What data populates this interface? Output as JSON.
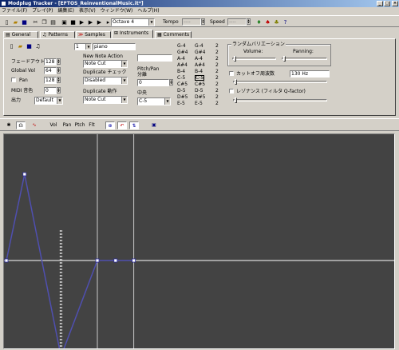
{
  "window": {
    "title": "Modplug Tracker - [EFTOS_ReinventionalMusic.it*]",
    "controls": [
      "_",
      "□",
      "×"
    ]
  },
  "menu": [
    "ファイル(F)",
    "プレイ(P)",
    "編集(E)",
    "表示(V)",
    "ウィンドウ(W)",
    "ヘルプ(H)"
  ],
  "toolbar": {
    "octave": "Octave 4",
    "tempo_label": "Tempo",
    "tempo_value": "----",
    "speed_label": "Speed",
    "speed_value": "----"
  },
  "tabs": [
    {
      "label": "General"
    },
    {
      "label": "Patterns"
    },
    {
      "label": "Samples"
    },
    {
      "label": "Instruments"
    },
    {
      "label": "Comments"
    }
  ],
  "instrument": {
    "number": "1",
    "name": "piano",
    "fadeout_label": "フェードアウト",
    "fadeout_value": "128",
    "global_vol_label": "Global Vol",
    "global_vol_value": "64",
    "pan_label": "Pan",
    "pan_value": "128",
    "midi_label": "MIDI 音色",
    "midi_value": "0",
    "output_label": "出力",
    "output_value": "Default"
  },
  "nna": {
    "title": "New Note Action",
    "value": "Note Cut",
    "duplicate_check_label": "Duplicate チェック",
    "duplicate_check_value": "Disabled",
    "duplicate_action_label": "Duplicate 動作",
    "duplicate_action_value": "Note Cut"
  },
  "pitch_pan": {
    "title": "Pitch/Pan",
    "separation_label": "分離",
    "separation_value": "0",
    "center_label": "中央",
    "center_value": "C-5"
  },
  "note_map": [
    [
      "G-4",
      "G-4",
      "2"
    ],
    [
      "G#4",
      "G#4",
      "2"
    ],
    [
      "A-4",
      "A-4",
      "2"
    ],
    [
      "A#4",
      "A#4",
      "2"
    ],
    [
      "B-4",
      "B-4",
      "2"
    ],
    [
      "C-5",
      "C-5",
      "2"
    ],
    [
      "C#5",
      "C#5",
      "2"
    ],
    [
      "D-5",
      "D-5",
      "2"
    ],
    [
      "D#5",
      "D#5",
      "2"
    ],
    [
      "E-5",
      "E-5",
      "2"
    ]
  ],
  "random_variation": {
    "title": "ランダムバリエーション",
    "volume_label": "Volume:",
    "panning_label": "Panning:",
    "cutoff_label": "カットオフ周波数",
    "cutoff_value": "130 Hz",
    "resonance_label": "レゾナンス (フィルタ Q-factor)"
  },
  "envelope_toolbar": {
    "vol": "Vol",
    "pan": "Pan",
    "pitch": "Ptch",
    "filter": "Flt"
  },
  "envelope": {
    "points": [
      {
        "tick": 0,
        "value": 0
      },
      {
        "tick": 10,
        "value": 0.9
      },
      {
        "tick": 30,
        "value": -1
      },
      {
        "tick": 50,
        "value": 0
      },
      {
        "tick": 60,
        "value": 0
      },
      {
        "tick": 70,
        "value": 0
      }
    ],
    "sustain_tick": 30,
    "loop_start_tick": 50,
    "loop_end_tick": 70,
    "line_color": "#4f4fb0",
    "background_color": "#434343"
  }
}
